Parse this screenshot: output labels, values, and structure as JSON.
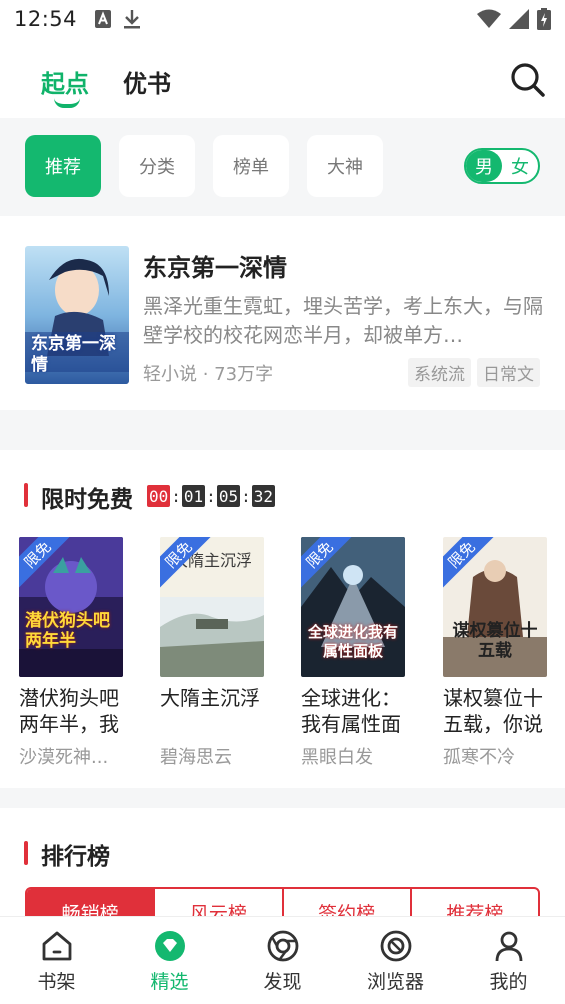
{
  "status_bar": {
    "time": "12:54"
  },
  "header": {
    "tabs": [
      {
        "label": "起点"
      },
      {
        "label": "优书"
      }
    ]
  },
  "categories": {
    "pills": [
      {
        "label": "推荐"
      },
      {
        "label": "分类"
      },
      {
        "label": "榜单"
      },
      {
        "label": "大神"
      }
    ],
    "gender": {
      "male": "男",
      "female": "女"
    }
  },
  "featured": {
    "title": "东京第一深情",
    "cover_text": "东京第一深情",
    "description": "黑泽光重生霓虹，埋头苦学，考上东大，与隔壁学校的校花网恋半月，却被单方…",
    "meta": "轻小说 · 73万字",
    "tags": [
      "系统流",
      "日常文"
    ]
  },
  "limited_free": {
    "title": "限时免费",
    "countdown": [
      "00",
      "01",
      "05",
      "32"
    ],
    "badge": "限免",
    "books": [
      {
        "title": "潜伏狗头吧两年半，我",
        "author": "沙漠死神...",
        "cover_text": "潜伏狗头吧两年半"
      },
      {
        "title": "大隋主沉浮",
        "author": "碧海思云",
        "cover_text": "大隋主沉浮"
      },
      {
        "title": "全球进化：我有属性面",
        "author": "黑眼白发",
        "cover_text": "全球进化我有属性面板"
      },
      {
        "title": "谋权篡位十五载，你说",
        "author": "孤寒不冷",
        "cover_text": "谋权篡位十五载"
      }
    ]
  },
  "ranking": {
    "title": "排行榜",
    "tabs": [
      "畅销榜",
      "风云榜",
      "签约榜",
      "推荐榜"
    ]
  },
  "bottom_nav": [
    {
      "label": "书架",
      "icon": "home-icon"
    },
    {
      "label": "精选",
      "icon": "featured-icon"
    },
    {
      "label": "发现",
      "icon": "discover-icon"
    },
    {
      "label": "浏览器",
      "icon": "browser-icon"
    },
    {
      "label": "我的",
      "icon": "profile-icon"
    }
  ],
  "colors": {
    "accent": "#14b86f",
    "rank_red": "#e0303a",
    "free_badge": "#3a6fe0"
  }
}
